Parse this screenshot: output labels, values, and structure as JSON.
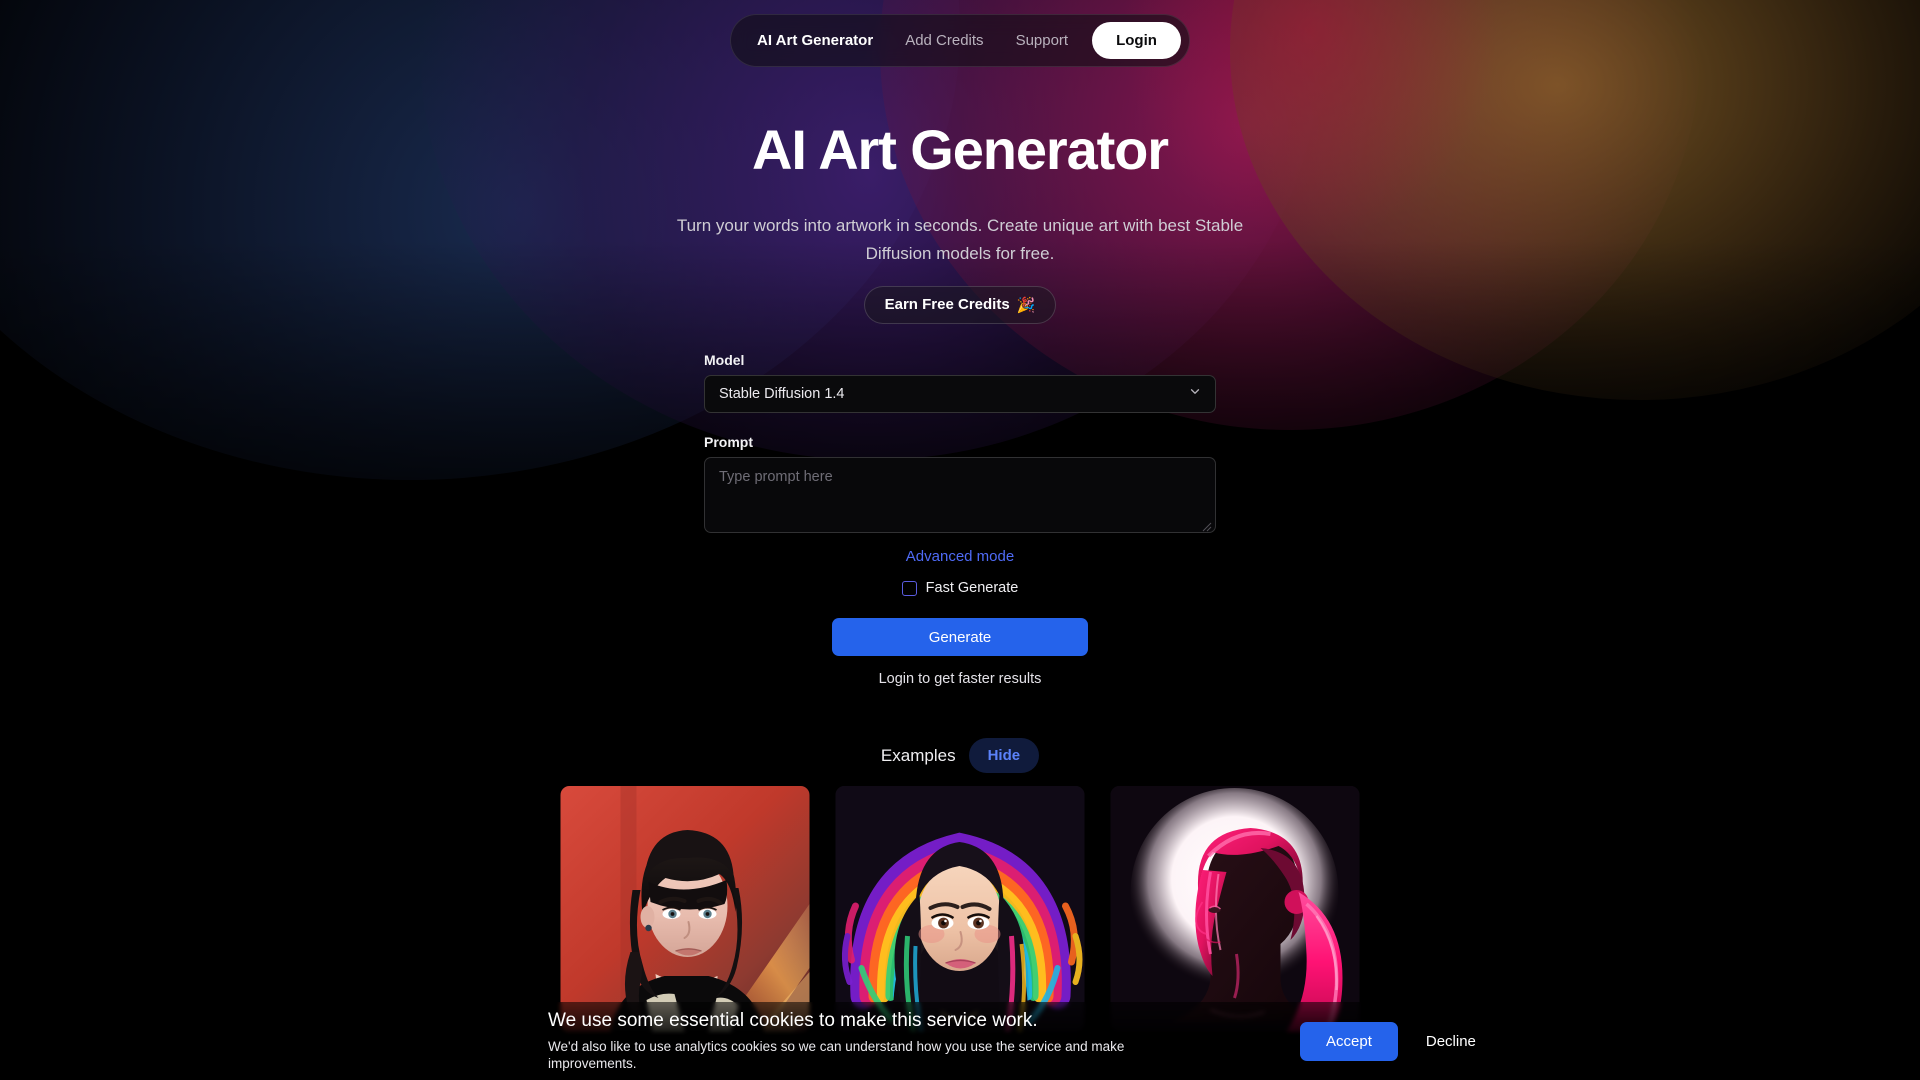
{
  "nav": {
    "brand": "AI Art Generator",
    "links": [
      {
        "label": "AI Art Generator",
        "active": true
      },
      {
        "label": "Add Credits",
        "active": false
      },
      {
        "label": "Support",
        "active": false
      }
    ],
    "login_label": "Login"
  },
  "hero": {
    "title": "AI Art Generator",
    "subtitle": "Turn your words into artwork in seconds. Create unique art with best Stable Diffusion models for free.",
    "badge_label": "Earn Free Credits",
    "badge_emoji": "🎉"
  },
  "form": {
    "model_label": "Model",
    "model_value": "Stable Diffusion 1.4",
    "model_chevron_icon": "chevron-down-icon",
    "prompt_label": "Prompt",
    "prompt_value": "",
    "prompt_placeholder": "Type prompt here",
    "advanced_mode_label": "Advanced mode",
    "fast_generate_label": "Fast Generate",
    "fast_generate_checked": false,
    "generate_label": "Generate",
    "login_hint": "Login to get faster results"
  },
  "examples": {
    "title": "Examples",
    "toggle_label": "Hide",
    "items": [
      {
        "alt": "Portrait of woman with dark bangs and black turtleneck on warm red background"
      },
      {
        "alt": "Portrait of woman with vivid rainbow hair and colorful aura"
      },
      {
        "alt": "Neon pink side profile silhouette of woman with ponytail against white glow"
      }
    ]
  },
  "cookies": {
    "line1": "We use some essential cookies to make this service work.",
    "line2": "We'd also like to use analytics cookies so we can understand how you use the service and make improvements.",
    "accept_label": "Accept",
    "decline_label": "Decline"
  },
  "colors": {
    "accent_blue": "#2563eb",
    "link_blue": "#4f6bf6",
    "hide_pill_text": "#5b82fa",
    "checkbox_border": "#5a5ce0",
    "page_background": "#000000"
  }
}
